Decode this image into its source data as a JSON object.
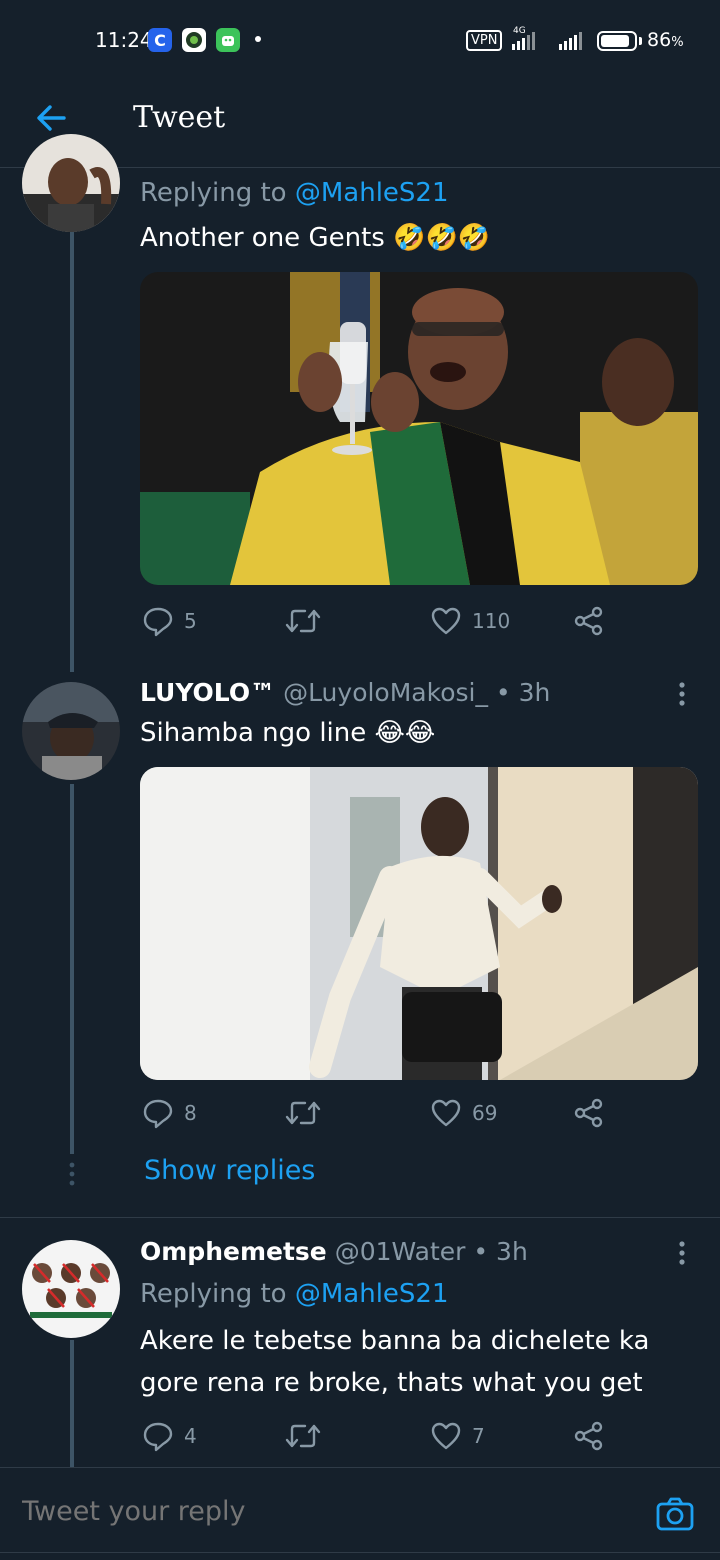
{
  "status_bar": {
    "time": "11:24",
    "vpn": "VPN",
    "network": "4G",
    "battery": "86",
    "battery_unit": "%",
    "battery_level": 0.86
  },
  "header": {
    "title": "Tweet",
    "back_icon": "arrow-left-icon"
  },
  "tweets": [
    {
      "replying_prefix": "Replying to ",
      "replying_to": "@MahleS21",
      "text": "Another one Gents 🤣🤣🤣",
      "replies": "5",
      "retweets": "",
      "likes": "110"
    },
    {
      "name": "LUYOLO™",
      "handle_time": "@LuyoloMakosi_ • 3h",
      "text": "Sihamba ngo line 😂😂",
      "replies": "8",
      "retweets": "",
      "likes": "69"
    },
    {
      "name": "Omphemetse",
      "handle_time": "@01Water • 3h",
      "replying_prefix": "Replying to ",
      "replying_to": "@MahleS21",
      "text": "Akere le tebetse banna ba dichelete ka gore rena re broke, thats what you get",
      "replies": "4",
      "retweets": "",
      "likes": "7"
    }
  ],
  "show_replies": "Show replies",
  "composer": {
    "placeholder": "Tweet your reply"
  },
  "colors": {
    "background": "#15202b",
    "accent": "#1da1f2",
    "secondary_text": "#8899a6",
    "divider": "#2f3b47"
  }
}
